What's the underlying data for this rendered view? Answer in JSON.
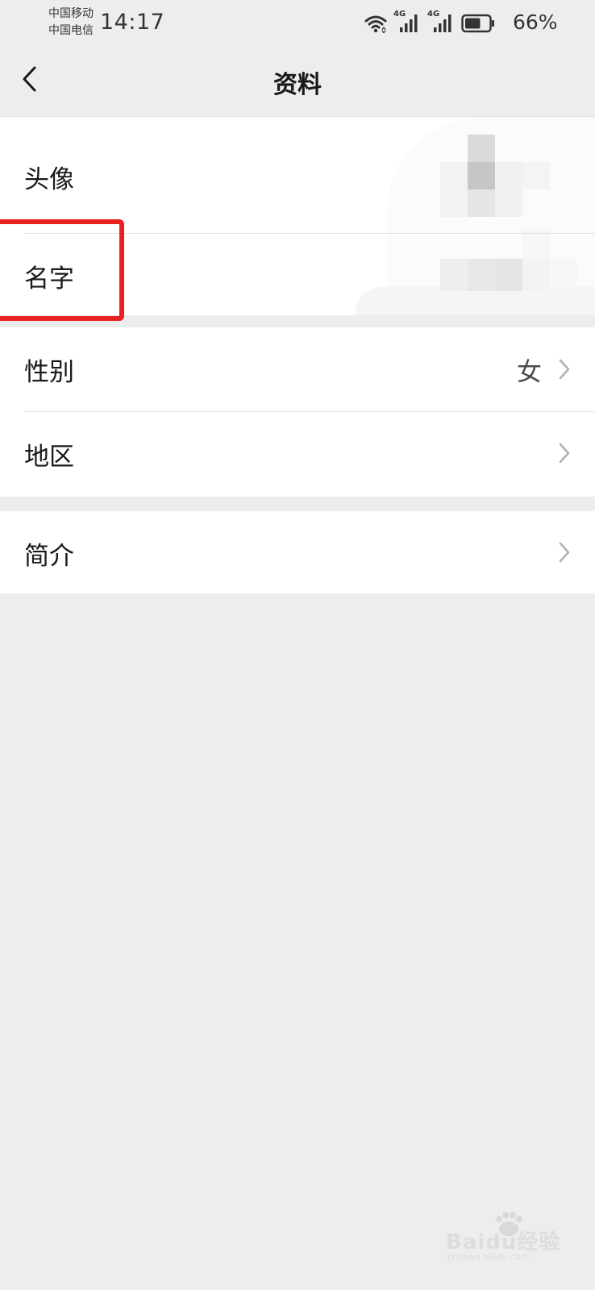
{
  "status_bar": {
    "carrier_1": "中国移动",
    "carrier_2": "中国电信",
    "time": "14:17",
    "network_1": "4G",
    "network_2": "4G",
    "battery_percent": "66%",
    "battery_level": 0.66,
    "icons": [
      "wifi-icon",
      "signal-icon",
      "signal-icon",
      "battery-icon"
    ]
  },
  "nav": {
    "back_icon": "chevron-left-icon",
    "title": "资料"
  },
  "profile": {
    "rows": [
      {
        "label": "头像",
        "value": "",
        "icon": "avatar-image"
      },
      {
        "label": "名字",
        "value": ""
      },
      {
        "label": "性别",
        "value": "女",
        "icon": "chevron-right-icon"
      },
      {
        "label": "地区",
        "value": "",
        "icon": "chevron-right-icon"
      },
      {
        "label": "简介",
        "value": "",
        "icon": "chevron-right-icon"
      }
    ]
  },
  "colors": {
    "page_bg": "#ededed",
    "row_bg": "#ffffff",
    "highlight": "#e8231f",
    "divider": "#e3e3e3"
  },
  "watermark": {
    "text": "Baidu经验",
    "subtext": "jingyan.baidu.com"
  }
}
